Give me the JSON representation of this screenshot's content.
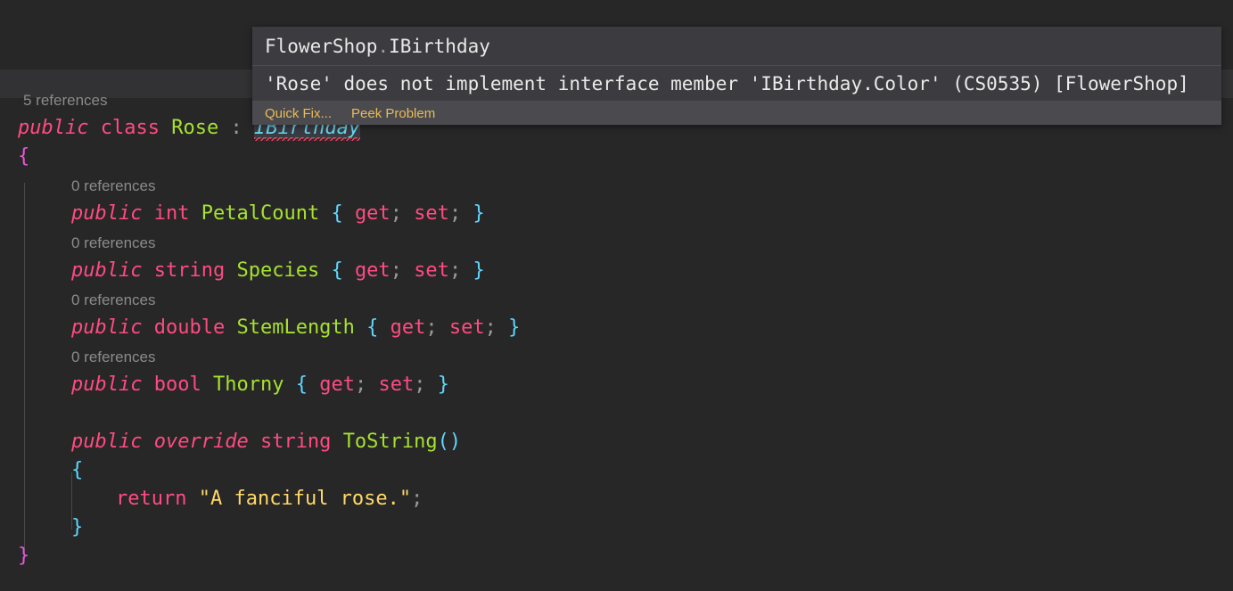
{
  "editor": {
    "language": "csharp",
    "background": "#272728",
    "current_line_background": "#323234",
    "codelens": {
      "class_references": "5 references",
      "petalcount_references": "0 references",
      "species_references": "0 references",
      "stemlength_references": "0 references",
      "thorny_references": "0 references"
    },
    "lines": {
      "class_decl": {
        "public": "public",
        "class": "class",
        "name": "Rose",
        "colon": ":",
        "interface": "IBirthday"
      },
      "class_open_brace": "{",
      "class_close_brace": "}",
      "properties": [
        {
          "modifier": "public",
          "type": "int",
          "name": "PetalCount",
          "open": "{",
          "get": "get",
          "semi1": ";",
          "set": "set",
          "semi2": ";",
          "close": "}"
        },
        {
          "modifier": "public",
          "type": "string",
          "name": "Species",
          "open": "{",
          "get": "get",
          "semi1": ";",
          "set": "set",
          "semi2": ";",
          "close": "}"
        },
        {
          "modifier": "public",
          "type": "double",
          "name": "StemLength",
          "open": "{",
          "get": "get",
          "semi1": ";",
          "set": "set",
          "semi2": ";",
          "close": "}"
        },
        {
          "modifier": "public",
          "type": "bool",
          "name": "Thorny",
          "open": "{",
          "get": "get",
          "semi1": ";",
          "set": "set",
          "semi2": ";",
          "close": "}"
        }
      ],
      "method": {
        "modifier": "public",
        "override": "override",
        "return_type": "string",
        "name": "ToString",
        "parens": "()",
        "open_brace": "{",
        "close_brace": "}",
        "body": {
          "return_keyword": "return",
          "string_literal": "\"A fanciful rose.\"",
          "semicolon": ";"
        }
      }
    },
    "colors": {
      "keyword": "#ff4b82",
      "type_name": "#a6e22e",
      "interface": "#66d9ef",
      "bracket_level1": "#5fd7ff",
      "bracket_level0": "#e957d9",
      "string": "#ffd866",
      "punctuation": "#9a9a9a",
      "codelens_text": "#8b8b8b",
      "squiggle_error": "#f0405c"
    }
  },
  "hover_widget": {
    "header": {
      "namespace": "FlowerShop",
      "separator": ".",
      "type": "IBirthday"
    },
    "message": "'Rose' does not implement interface member 'IBirthday.Color' (CS0535) [FlowerShop]",
    "actions": [
      {
        "label": "Quick Fix..."
      },
      {
        "label": "Peek Problem"
      }
    ],
    "action_color": "#e8bb59"
  }
}
